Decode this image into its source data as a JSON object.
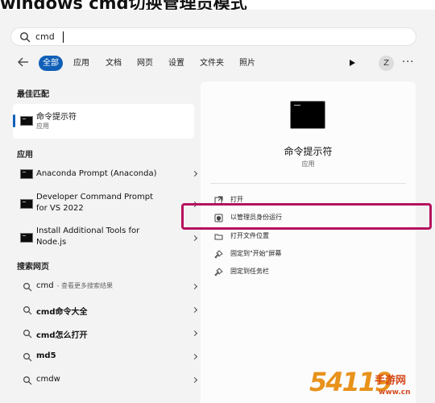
{
  "page_title": "windows cmd切换管理员模式",
  "search": {
    "query": "cmd"
  },
  "filters": {
    "tabs": [
      {
        "label": "全部"
      },
      {
        "label": "应用"
      },
      {
        "label": "文档"
      },
      {
        "label": "网页"
      },
      {
        "label": "设置"
      },
      {
        "label": "文件夹"
      },
      {
        "label": "照片"
      }
    ],
    "active": "全部",
    "avatar": "Z",
    "more": "···"
  },
  "best_match": {
    "heading": "最佳匹配",
    "title": "命令提示符",
    "subtitle": "应用"
  },
  "apps": {
    "heading": "应用",
    "items": [
      {
        "label": "Anaconda Prompt (Anaconda)"
      },
      {
        "label_line1": "Developer Command Prompt",
        "label_line2": "for VS 2022"
      },
      {
        "label_line1": "Install Additional Tools for",
        "label_line2": "Node.js"
      }
    ]
  },
  "web": {
    "heading": "搜索网页",
    "items": [
      {
        "text": "cmd",
        "sub": "- 查看更多搜索结果"
      },
      {
        "text": "cmd命令大全"
      },
      {
        "text": "cmd怎么打开"
      },
      {
        "text": "md5"
      },
      {
        "text": "cmdw"
      }
    ]
  },
  "detail": {
    "title": "命令提示符",
    "type": "应用",
    "actions": [
      {
        "label": "打开",
        "icon": "open-icon"
      },
      {
        "label": "以管理员身份运行",
        "icon": "shield-admin-icon"
      },
      {
        "label": "打开文件位置",
        "icon": "folder-icon"
      },
      {
        "label": "固定到\"开始\"屏幕",
        "icon": "pin-icon"
      },
      {
        "label": "固定到任务栏",
        "icon": "pin-icon"
      }
    ]
  },
  "watermark": {
    "number": "54119",
    "text": "手游网",
    "url": "www.cn"
  },
  "colors": {
    "accent": "#0f5fb7",
    "highlight": "#b5125e"
  }
}
